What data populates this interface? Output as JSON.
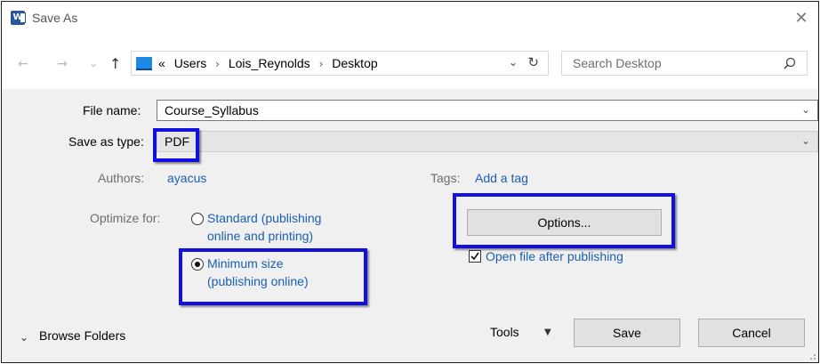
{
  "window": {
    "title": "Save As",
    "close_glyph": "✕"
  },
  "nav": {
    "back_glyph": "←",
    "forward_glyph": "→",
    "recent_glyph": "⌄",
    "up_glyph": "↑",
    "breadcrumb_prefix": "«",
    "breadcrumbs": [
      "Users",
      "Lois_Reynolds",
      "Desktop"
    ],
    "crumb_separator": "›",
    "dropdown_glyph": "⌄",
    "refresh_glyph": "↻"
  },
  "search": {
    "placeholder": "Search Desktop"
  },
  "form": {
    "file_name_label": "File name:",
    "file_name_value": "Course_Syllabus",
    "save_type_label": "Save as type:",
    "save_type_value": "PDF",
    "dropdown_glyph": "⌄"
  },
  "metadata": {
    "authors_label": "Authors:",
    "authors_value": "ayacus",
    "tags_label": "Tags:",
    "tags_value": "Add a tag"
  },
  "optimize": {
    "label": "Optimize for:",
    "standard_line1": "Standard (publishing",
    "standard_line2": "online and printing)",
    "minimum_line1": "Minimum size",
    "minimum_line2": "(publishing online)",
    "selected": "minimum"
  },
  "options_button": "Options...",
  "open_after": {
    "label": "Open file after publishing",
    "checked": true
  },
  "footer": {
    "browse_label": "Browse Folders",
    "browse_glyph": "⌄",
    "tools_label": "Tools",
    "tools_glyph": "▼",
    "save_label": "Save",
    "cancel_label": "Cancel"
  },
  "colors": {
    "highlight": "#1010e0",
    "link": "#1a5fb4",
    "word_brand": "#2b579a"
  }
}
